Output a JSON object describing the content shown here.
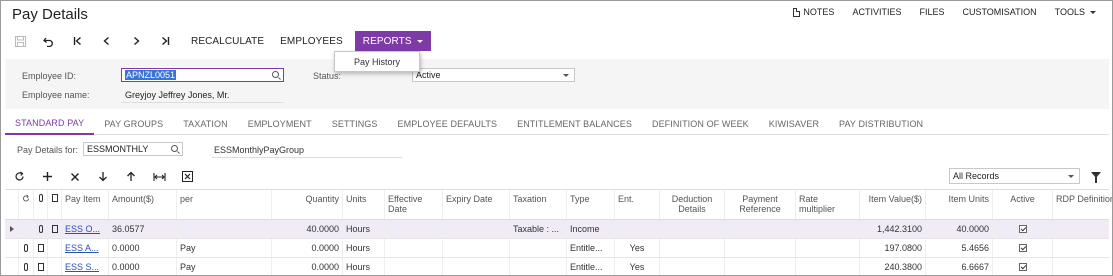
{
  "app": {
    "title": "Pay Details"
  },
  "topmenu": {
    "notes": "NOTES",
    "activities": "ACTIVITIES",
    "files": "FILES",
    "customisation": "CUSTOMISATION",
    "tools": "TOOLS"
  },
  "toolbar": {
    "recalculate": "RECALCULATE",
    "employees": "EMPLOYEES",
    "reports": "REPORTS"
  },
  "reports_menu": {
    "pay_history": "Pay History"
  },
  "form": {
    "employee_id_label": "Employee ID:",
    "employee_id_value": "APNZL0051",
    "employee_name_label": "Employee name:",
    "employee_name_value": "Greyjoy Jeffrey Jones, Mr.",
    "status_label": "Status:",
    "status_value": "Active"
  },
  "tabs": [
    "STANDARD PAY",
    "PAY GROUPS",
    "TAXATION",
    "EMPLOYMENT",
    "SETTINGS",
    "EMPLOYEE DEFAULTS",
    "ENTITLEMENT BALANCES",
    "DEFINITION OF WEEK",
    "KIWISAVER",
    "PAY DISTRIBUTION"
  ],
  "paydetails": {
    "label": "Pay Details for:",
    "value": "ESSMONTHLY",
    "group": "ESSMonthlyPayGroup"
  },
  "grid_filter": {
    "value": "All Records"
  },
  "grid": {
    "headers": [
      "Pay Item",
      "Amount($)",
      "per",
      "Quantity",
      "Units",
      "Effective Date",
      "Expiry Date",
      "Taxation",
      "Type",
      "Ent.",
      "Deduction Details",
      "Payment Reference",
      "Rate multiplier",
      "Item Value($)",
      "Item Units",
      "Active",
      "RDP Definition"
    ],
    "rows": [
      {
        "pay_item": "ESS O...",
        "amount": "36.0577",
        "per": "",
        "quantity": "40.0000",
        "units": "Hours",
        "effective": "",
        "expiry": "",
        "taxation": "Taxable : ...",
        "type": "Income",
        "ent": "",
        "deduction": "",
        "payref": "",
        "rate": "",
        "item_value": "1,442.3100",
        "item_units": "40.0000",
        "active": true,
        "rdp": ""
      },
      {
        "pay_item": "ESS A...",
        "amount": "0.0000",
        "per": "Pay",
        "quantity": "0.0000",
        "units": "Hours",
        "effective": "",
        "expiry": "",
        "taxation": "",
        "type": "Entitle...",
        "ent": "Yes",
        "deduction": "",
        "payref": "",
        "rate": "",
        "item_value": "197.0800",
        "item_units": "5.4656",
        "active": true,
        "rdp": ""
      },
      {
        "pay_item": "ESS S...",
        "amount": "0.0000",
        "per": "Pay",
        "quantity": "0.0000",
        "units": "Hours",
        "effective": "",
        "expiry": "",
        "taxation": "",
        "type": "Entitle...",
        "ent": "Yes",
        "deduction": "",
        "payref": "",
        "rate": "",
        "item_value": "240.3800",
        "item_units": "6.6667",
        "active": true,
        "rdp": ""
      }
    ]
  },
  "colors": {
    "accent": "#7e3ba8",
    "link": "#2a4fb5",
    "selection": "#3874d8"
  }
}
